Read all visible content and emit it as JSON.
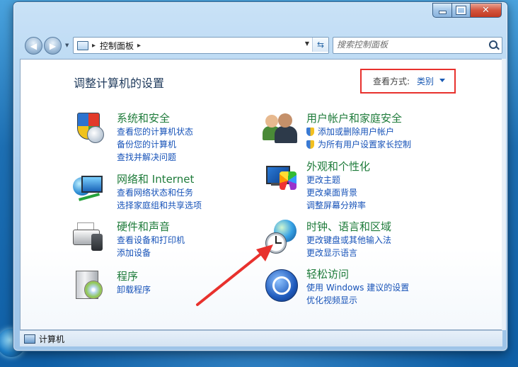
{
  "breadcrumb": {
    "current": "控制面板",
    "sep": "▸"
  },
  "search": {
    "placeholder": "搜索控制面板"
  },
  "page_title": "调整计算机的设置",
  "view": {
    "label": "查看方式:",
    "value": "类别"
  },
  "categories": [
    {
      "title": "系统和安全",
      "links": [
        "查看您的计算机状态",
        "备份您的计算机",
        "查找并解决问题"
      ]
    },
    {
      "title": "网络和 Internet",
      "links": [
        "查看网络状态和任务",
        "选择家庭组和共享选项"
      ]
    },
    {
      "title": "硬件和声音",
      "links": [
        "查看设备和打印机",
        "添加设备"
      ]
    },
    {
      "title": "程序",
      "links": [
        "卸载程序"
      ]
    },
    {
      "title": "用户帐户和家庭安全",
      "links": [
        "添加或删除用户帐户",
        "为所有用户设置家长控制"
      ]
    },
    {
      "title": "外观和个性化",
      "links": [
        "更改主题",
        "更改桌面背景",
        "调整屏幕分辨率"
      ]
    },
    {
      "title": "时钟、语言和区域",
      "links": [
        "更改键盘或其他输入法",
        "更改显示语言"
      ]
    },
    {
      "title": "轻松访问",
      "links": [
        "使用 Windows 建议的设置",
        "优化视频显示"
      ]
    }
  ],
  "status": {
    "text": "计算机"
  },
  "colors": {
    "category_title": "#1e7b3a",
    "link": "#1652b8",
    "highlight_box": "#e8312d",
    "arrow": "#e8312d"
  },
  "icons": {
    "minimize": "minimize-icon",
    "maximize": "maximize-icon",
    "close": "close-icon",
    "back": "back-arrow-icon",
    "forward": "forward-arrow-icon",
    "refresh": "refresh-icon",
    "search": "search-icon"
  }
}
